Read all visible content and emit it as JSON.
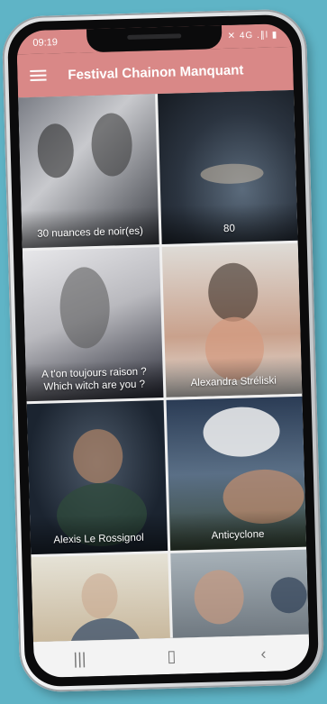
{
  "status": {
    "time": "09:19",
    "icons": "✕ 4G .∥l ▮"
  },
  "app": {
    "title": "Festival Chainon Manquant",
    "accent": "#d98887"
  },
  "tiles": [
    {
      "label": "30 nuances de noir(es)"
    },
    {
      "label": "80"
    },
    {
      "label": "A t'on toujours raison ?\nWhich witch are you ?"
    },
    {
      "label": "Alexandra Stréliski"
    },
    {
      "label": "Alexis Le Rossignol"
    },
    {
      "label": "Anticyclone"
    },
    {
      "label": ""
    },
    {
      "label": ""
    }
  ],
  "navbar": {
    "recent": "|||",
    "home": "▯",
    "back": "‹"
  }
}
